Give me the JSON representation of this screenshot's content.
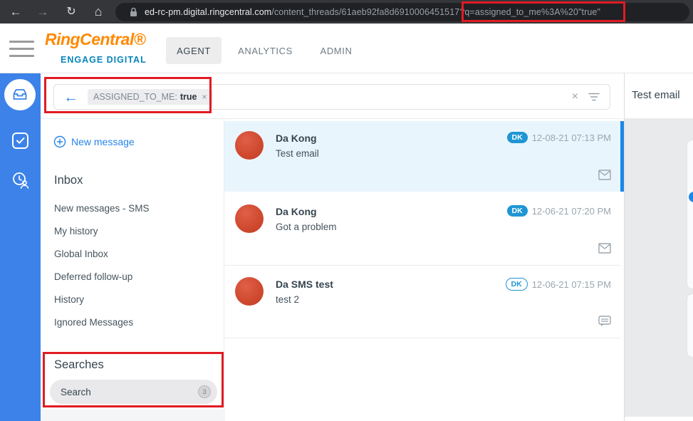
{
  "browser": {
    "url_host": "ed-rc-pm.digital.ringcentral.com",
    "url_path": "/content_threads/61aeb92fa8d6910006451517",
    "url_query": "?q=assigned_to_me%3A%20\"true\"",
    "back_glyph": "←",
    "forward_glyph": "→",
    "reload_glyph": "↻",
    "home_glyph": "⌂"
  },
  "header": {
    "logo_line1": "RingCentral®",
    "logo_line2": "ENGAGE DIGITAL",
    "tabs": [
      {
        "label": "AGENT",
        "active": true
      },
      {
        "label": "ANALYTICS",
        "active": false
      },
      {
        "label": "ADMIN",
        "active": false
      }
    ]
  },
  "filter_bar": {
    "chip_label": "ASSIGNED_TO_ME:",
    "chip_value": "true",
    "chip_remove": "×",
    "clear_glyph": "×"
  },
  "sidebar": {
    "new_message_label": "New message",
    "inbox_heading": "Inbox",
    "items": [
      "New messages - SMS",
      "My history",
      "Global Inbox",
      "Deferred follow-up",
      "History",
      "Ignored Messages"
    ],
    "searches_heading": "Searches",
    "search_item": {
      "label": "Search",
      "badge": "3"
    }
  },
  "thread_list": {
    "items": [
      {
        "name": "Da Kong",
        "preview": "Test email",
        "badge": "DK",
        "badge_style": "filled",
        "time": "12-08-21 07:13 PM",
        "channel": "email",
        "selected": true
      },
      {
        "name": "Da Kong",
        "preview": "Got a problem",
        "badge": "DK",
        "badge_style": "filled",
        "time": "12-06-21 07:20 PM",
        "channel": "email",
        "selected": false
      },
      {
        "name": "Da SMS test",
        "preview": "test 2",
        "badge": "DK",
        "badge_style": "outlined",
        "time": "12-06-21 07:15 PM",
        "channel": "sms",
        "selected": false
      }
    ]
  },
  "detail_panel": {
    "title": "Test email"
  },
  "colors": {
    "rail_blue": "#3c82e9",
    "accent_blue": "#2684ea",
    "badge_blue": "#1e96d4",
    "annotation_red": "#e11b23",
    "avatar_red": "#d04a30",
    "selected_row": "#e9f5fd"
  }
}
